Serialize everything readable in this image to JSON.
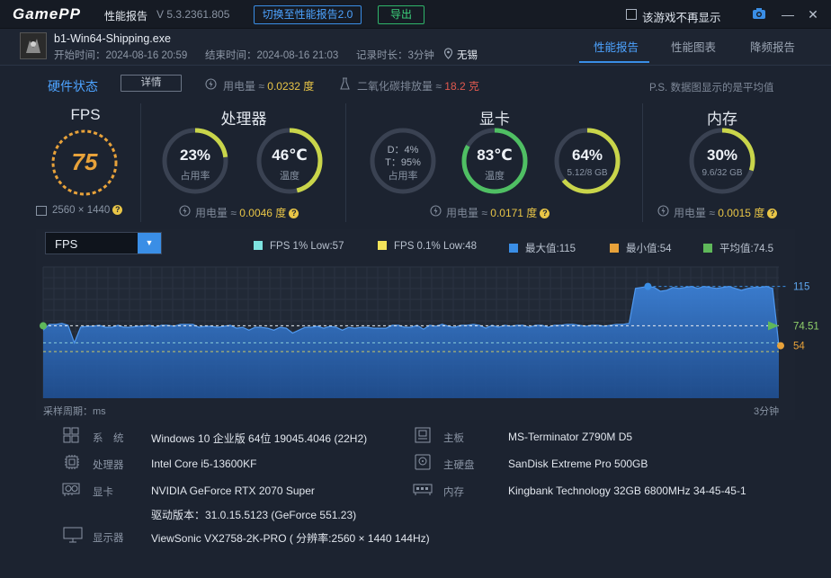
{
  "app": {
    "logo": "GamePP",
    "title": "性能报告",
    "version": "V 5.3.2361.805",
    "switch_btn": "切换至性能报告2.0",
    "export_btn": "导出",
    "no_show_label": "该游戏不再显示",
    "minimize": "—",
    "close": "✕"
  },
  "game": {
    "exe": "b1-Win64-Shipping.exe",
    "start": "开始时间：2024-08-16 20:59",
    "end": "结束时间：2024-08-16 21:03",
    "duration": "记录时长：3分钟",
    "location": "无锡"
  },
  "tabs": [
    "性能报告",
    "性能图表",
    "降频报告"
  ],
  "summary": {
    "hw_status": "硬件状态",
    "detail_btn": "详情",
    "power_label": "用电量 ≈ ",
    "power_value": "0.0232 度",
    "co2_label": "二氧化碳排放量 ≈ ",
    "co2_value": "18.2 克",
    "note": "P.S. 数据图显示的是平均值"
  },
  "fps": {
    "title": "FPS",
    "value": "75",
    "resolution": "2560 × 1440"
  },
  "cpu": {
    "title": "处理器",
    "usage": "23%",
    "usage_label": "占用率",
    "usage_frac": 0.23,
    "temp": "46℃",
    "temp_label": "温度",
    "temp_frac": 0.46,
    "power_label": "用电量 ≈ ",
    "power_value": "0.0046 度"
  },
  "gpu": {
    "title": "显卡",
    "d": "D：4%",
    "t": "T：95%",
    "usage_label": "占用率",
    "temp": "83℃",
    "temp_label": "温度",
    "temp_frac": 0.83,
    "vram": "64%",
    "vram_sub": "5.12/8 GB",
    "vram_frac": 0.64,
    "power_label": "用电量 ≈ ",
    "power_value": "0.0171 度"
  },
  "mem": {
    "title": "内存",
    "usage": "30%",
    "usage_sub": "9.6/32 GB",
    "usage_frac": 0.3,
    "power_label": "用电量 ≈ ",
    "power_value": "0.0015 度"
  },
  "chart_controls": {
    "selected": "FPS",
    "legend": [
      {
        "label": "FPS 1% Low:57",
        "color": "#7ee3e0"
      },
      {
        "label": "FPS 0.1% Low:48",
        "color": "#f2e35a"
      },
      {
        "label": "最大值:115",
        "color": "#3a8ee6"
      },
      {
        "label": "最小值:54",
        "color": "#e8a23a"
      },
      {
        "label": "平均值:74.5",
        "color": "#5fb85a"
      }
    ],
    "x_left": "采样周期：ms",
    "x_right": "3分钟"
  },
  "chart_data": {
    "type": "area",
    "series": [
      {
        "name": "FPS",
        "values": [
          70,
          76,
          76,
          77,
          75,
          57,
          73,
          74,
          74,
          75,
          73,
          73,
          75,
          73,
          73,
          74,
          74,
          75,
          73,
          75,
          75,
          74,
          76,
          76,
          76,
          73,
          74,
          74,
          73,
          74,
          75,
          72,
          73,
          70,
          73,
          73,
          72,
          70,
          73,
          72,
          67,
          70,
          73,
          73,
          74,
          72,
          74,
          73,
          70,
          73,
          72,
          73,
          73,
          72,
          72,
          72,
          75,
          75,
          73,
          73,
          75,
          71,
          75,
          74,
          76,
          74,
          73,
          75,
          75,
          76,
          75,
          72,
          75,
          73,
          75,
          74,
          75,
          75,
          73,
          75,
          75,
          73,
          75,
          75,
          76,
          76,
          75,
          74,
          75,
          75,
          74,
          75,
          76,
          76,
          77,
          113,
          114,
          115,
          114,
          110,
          111,
          114,
          113,
          114,
          115,
          113,
          115,
          114,
          113,
          114,
          115,
          113,
          111,
          113,
          114,
          114,
          115,
          113,
          54
        ]
      }
    ],
    "max": 115,
    "avg": 74.51,
    "min": 54,
    "right_labels": [
      "115",
      "74.51",
      "54"
    ],
    "ylim": [
      0,
      135
    ]
  },
  "specs": {
    "os_label": "系　统",
    "os": "Windows 10 企业版 64位 19045.4046 (22H2)",
    "cpu_label": "处理器",
    "cpu": "Intel Core i5-13600KF",
    "gpu_label": "显卡",
    "gpu": "NVIDIA GeForce RTX 2070 Super",
    "driver": "驱动版本：31.0.15.5123 (GeForce 551.23)",
    "monitor_label": "显示器",
    "monitor": "ViewSonic VX2758-2K-PRO ( 分辨率:2560 × 1440 144Hz)",
    "mb_label": "主板",
    "mb": "MS-Terminator Z790M D5",
    "disk_label": "主硬盘",
    "disk": "SanDisk Extreme Pro 500GB",
    "ram_label": "内存",
    "ram": "Kingbank Technology 32GB 6800MHz 34-45-45-1"
  }
}
